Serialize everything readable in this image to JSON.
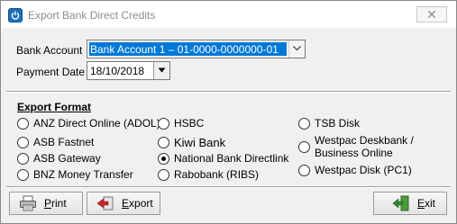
{
  "window": {
    "title": "Export Bank Direct Credits",
    "close_glyph": "✕"
  },
  "form": {
    "bank_account_label": "Bank Account",
    "bank_account_value": "Bank Account 1 – 01-0000-0000000-01",
    "payment_date_label": "Payment Date",
    "payment_date_value": "18/10/2018"
  },
  "export_format": {
    "title": "Export Format",
    "selected": "National Bank Directlink",
    "col1": [
      "ANZ  Direct Online (ADOL)",
      "ASB Fastnet",
      "ASB Gateway",
      "BNZ Money Transfer"
    ],
    "col2": [
      "HSBC",
      "Kiwi Bank",
      "National Bank Directlink",
      "Rabobank (RIBS)"
    ],
    "col3": [
      "TSB Disk",
      "Westpac Deskbank / Business Online",
      "Westpac Disk (PC1)"
    ]
  },
  "buttons": {
    "print_first": "P",
    "print_rest": "rint",
    "export_first": "E",
    "export_rest": "xport",
    "exit_first": "E",
    "exit_rest": "xit"
  },
  "icons": {
    "app": "power-icon",
    "dropdown": "chevron-down-icon",
    "print": "printer-icon",
    "export": "export-arrow-icon",
    "exit": "exit-door-icon"
  },
  "colors": {
    "selection": "#0078d7",
    "window_bg": "#f0f0f0"
  }
}
